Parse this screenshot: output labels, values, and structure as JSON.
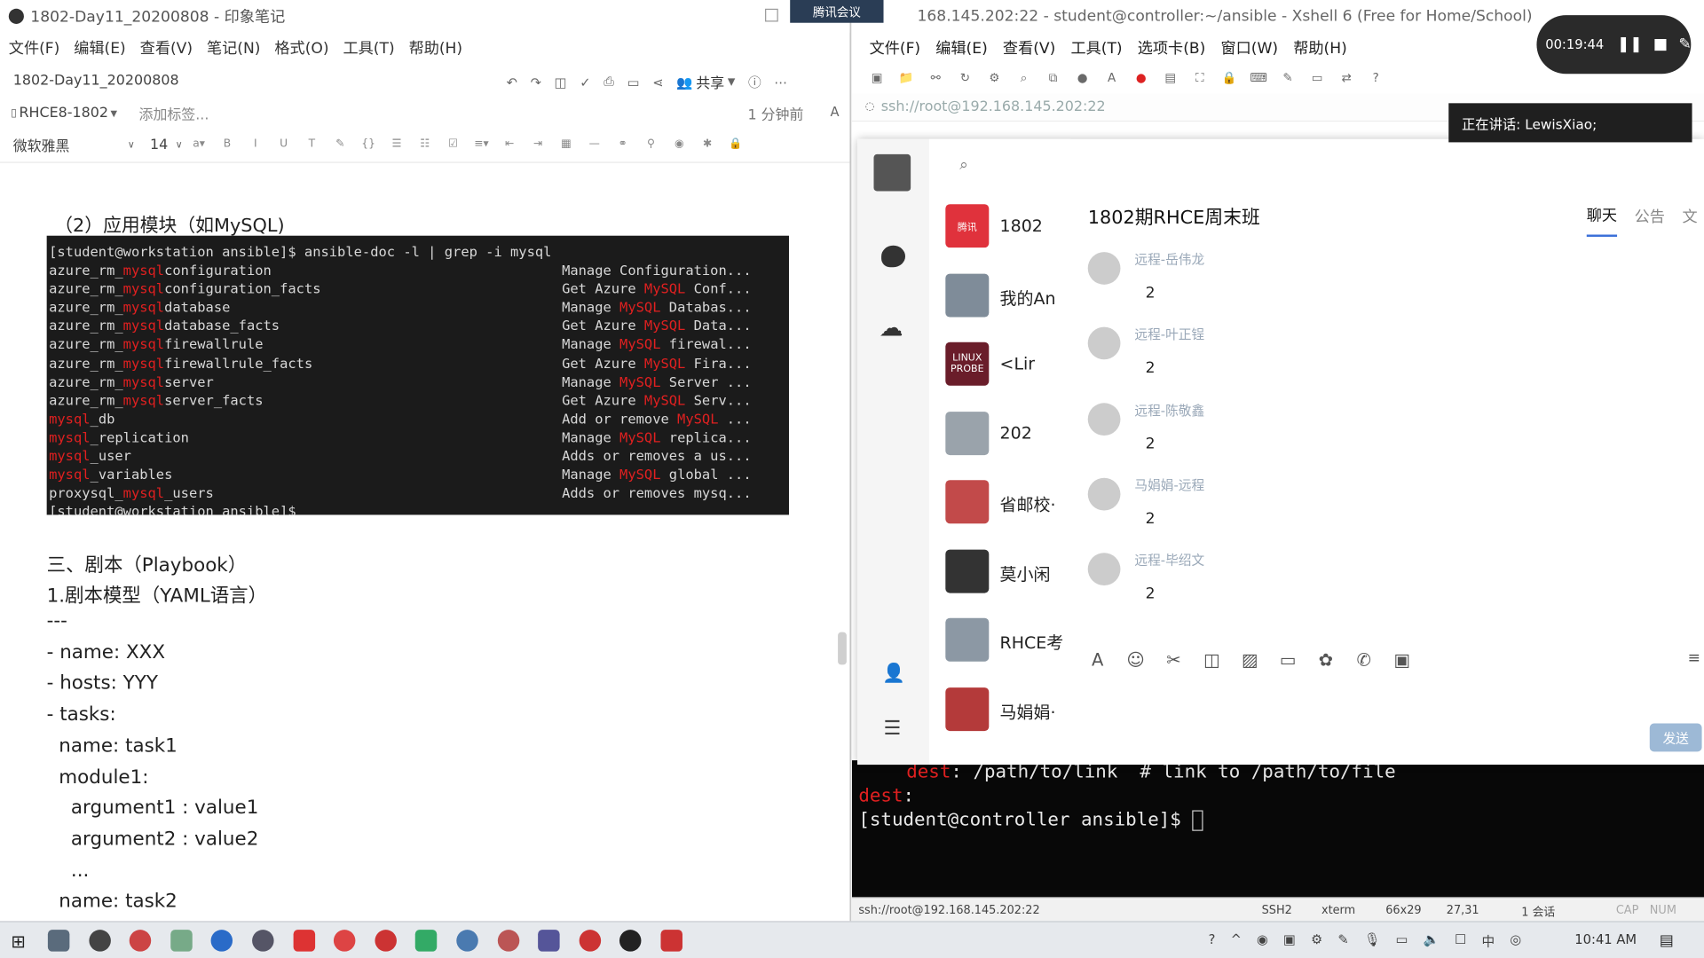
{
  "evernote": {
    "window_title": "1802-Day11_20200808 - 印象笔记",
    "menu": [
      "文件(F)",
      "编辑(E)",
      "查看(V)",
      "笔记(N)",
      "格式(O)",
      "工具(T)",
      "帮助(H)"
    ],
    "note_title": "1802-Day11_20200808",
    "share_label": "共享",
    "notebook": "RHCE8-1802",
    "add_tag_placeholder": "添加标签...",
    "modified": "1 分钟前",
    "font_name": "微软雅黑",
    "font_size": "14",
    "section_app_module": "（2）应用模块（如MySQL)",
    "terminal_lines": [
      {
        "l": "[student@workstation ansible]$ ansible-doc -l | grep -i mysql",
        "r": ""
      },
      {
        "l": "azure_rm_mysqlconfiguration",
        "r": "Manage Configuration..."
      },
      {
        "l": "azure_rm_mysqlconfiguration_facts",
        "r": "Get Azure MySQL Conf..."
      },
      {
        "l": "azure_rm_mysqldatabase",
        "r": "Manage MySQL Databas..."
      },
      {
        "l": "azure_rm_mysqldatabase_facts",
        "r": "Get Azure MySQL Data..."
      },
      {
        "l": "azure_rm_mysqlfirewallrule",
        "r": "Manage MySQL firewal..."
      },
      {
        "l": "azure_rm_mysqlfirewallrule_facts",
        "r": "Get Azure MySQL Fira..."
      },
      {
        "l": "azure_rm_mysqlserver",
        "r": "Manage MySQL Server ..."
      },
      {
        "l": "azure_rm_mysqlserver_facts",
        "r": "Get Azure MySQL Serv..."
      },
      {
        "l": "mysql_db",
        "r": "Add or remove MySQL ..."
      },
      {
        "l": "mysql_replication",
        "r": "Manage MySQL replica..."
      },
      {
        "l": "mysql_user",
        "r": "Adds or removes a us..."
      },
      {
        "l": "mysql_variables",
        "r": "Manage MySQL global ..."
      },
      {
        "l": "proxysql_mysql_users",
        "r": "Adds or removes mysq..."
      },
      {
        "l": "[student@workstation ansible]$",
        "r": ""
      }
    ],
    "section_playbook": "三、剧本（Playbook）",
    "section_yaml": "1.剧本模型（YAML语言）",
    "yaml_lines": [
      "---",
      "- name: XXX",
      "- hosts: YYY",
      "- tasks:",
      "  name: task1",
      "  module1:",
      "    argument1 : value1",
      "    argument2 : value2",
      "    ...",
      "  name: task2"
    ]
  },
  "xshell": {
    "window_title": "168.145.202:22 - student@controller:~/ansible - Xshell 6 (Free for Home/School)",
    "menu": [
      "文件(F)",
      "编辑(E)",
      "查看(V)",
      "工具(T)",
      "选项卡(B)",
      "窗口(W)",
      "帮助(H)"
    ],
    "address": "ssh://root@192.168.145.202:22",
    "terminal": {
      "line1_key": "dest",
      "line1_rest": ": /path/to/link  # link to /path/to/file",
      "line2_key": "dest",
      "line2_rest": ":",
      "prompt": "[student@controller ansible]$ "
    },
    "status": {
      "conn": "ssh://root@192.168.145.202:22",
      "proto": "SSH2",
      "term": "xterm",
      "size": "66x29",
      "pos": "27,31",
      "sessions": "1 会话",
      "cap": "CAP",
      "num": "NUM"
    }
  },
  "meeting": {
    "tab_label": "腾讯会议",
    "timer": "00:19:44",
    "speaking": "正在讲话: LewisXiao;"
  },
  "qq": {
    "contacts": [
      {
        "name": "1802",
        "color": "#e0323c",
        "label": "腾讯"
      },
      {
        "name": "我的An",
        "color": "#7f8c99",
        "label": ""
      },
      {
        "name": "<Lir",
        "color": "#6a1d2a",
        "label": "LINUX PROBE"
      },
      {
        "name": "202",
        "color": "#9aa3ab",
        "label": ""
      },
      {
        "name": "省邮校·",
        "color": "#c24a4a",
        "label": ""
      },
      {
        "name": "莫小闲",
        "color": "#333333",
        "label": ""
      },
      {
        "name": "RHCE考",
        "color": "#8c98a4",
        "label": ""
      },
      {
        "name": "马娟娟·",
        "color": "#b43a3a",
        "label": ""
      }
    ],
    "group_title": "1802期RHCE周末班",
    "tabs": [
      "聊天",
      "公告",
      "文"
    ],
    "members": [
      {
        "name": "远程-岳伟龙",
        "count": "2"
      },
      {
        "name": "远程-叶正锃",
        "count": "2"
      },
      {
        "name": "远程-陈敬鑫",
        "count": "2"
      },
      {
        "name": "马娟娟-远程",
        "count": "2"
      },
      {
        "name": "远程-毕绍文",
        "count": "2"
      }
    ],
    "send_label": "发送"
  },
  "taskbar": {
    "time": "10:41 AM"
  }
}
